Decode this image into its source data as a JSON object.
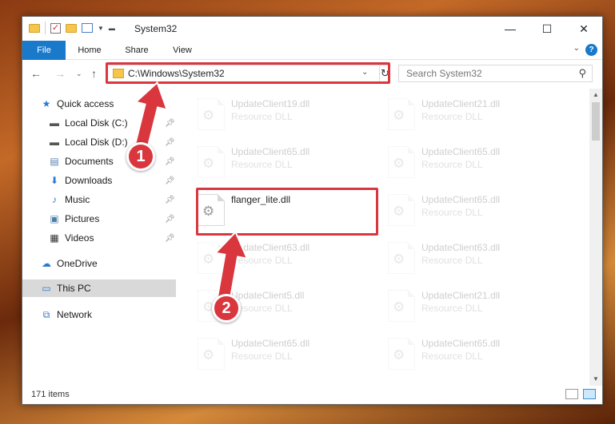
{
  "window": {
    "title": "System32",
    "controls": {
      "minimize": "—",
      "maximize": "☐",
      "close": "✕"
    }
  },
  "ribbon": {
    "tabs": [
      {
        "label": "File"
      },
      {
        "label": "Home"
      },
      {
        "label": "Share"
      },
      {
        "label": "View"
      }
    ],
    "help": "?"
  },
  "address": {
    "path": "C:\\Windows\\System32"
  },
  "search": {
    "placeholder": "Search System32"
  },
  "navpane": {
    "quick_access": "Quick access",
    "items": [
      {
        "label": "Local Disk (C:)"
      },
      {
        "label": "Local Disk (D:)"
      },
      {
        "label": "Documents"
      },
      {
        "label": "Downloads"
      },
      {
        "label": "Music"
      },
      {
        "label": "Pictures"
      },
      {
        "label": "Videos"
      }
    ],
    "onedrive": "OneDrive",
    "this_pc": "This PC",
    "network": "Network"
  },
  "files": {
    "left": [
      {
        "name": "UpdateClient19.dll",
        "kind": "Resource DLL"
      },
      {
        "name": "UpdateClient65.dll",
        "kind": "Resource DLL"
      },
      {
        "name": "flanger_lite.dll",
        "kind": ""
      },
      {
        "name": "UpdateClient63.dll",
        "kind": "Resource DLL"
      },
      {
        "name": "UpdateClient5.dll",
        "kind": "Resource DLL"
      },
      {
        "name": "UpdateClient65.dll",
        "kind": "Resource DLL"
      }
    ],
    "right": [
      {
        "name": "UpdateClient21.dll",
        "kind": "Resource DLL"
      },
      {
        "name": "UpdateClient65.dll",
        "kind": "Resource DLL"
      },
      {
        "name": "UpdateClient65.dll",
        "kind": "Resource DLL"
      },
      {
        "name": "UpdateClient63.dll",
        "kind": "Resource DLL"
      },
      {
        "name": "UpdateClient21.dll",
        "kind": "Resource DLL"
      },
      {
        "name": "UpdateClient65.dll",
        "kind": "Resource DLL"
      }
    ]
  },
  "status": {
    "item_count": "171 items"
  },
  "annotations": {
    "step1": "1",
    "step2": "2",
    "color": "#d9363e"
  }
}
